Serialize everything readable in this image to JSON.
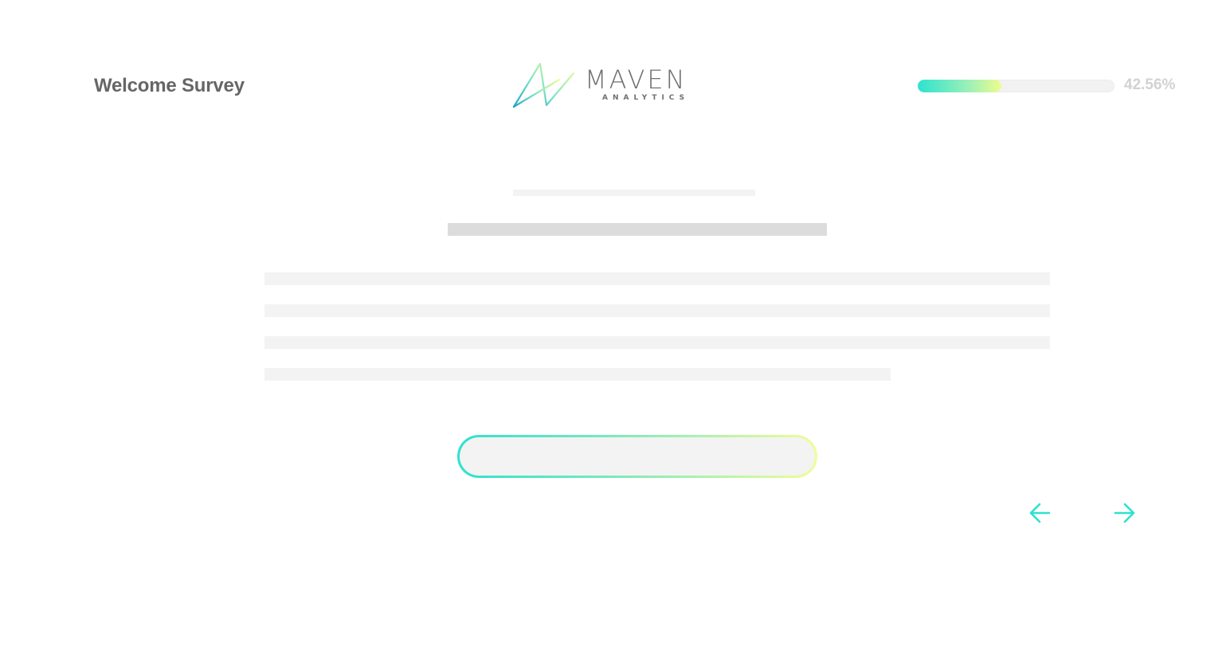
{
  "header": {
    "title": "Welcome Survey"
  },
  "logo": {
    "wordmark": "MAVEN",
    "tagline": "ANALYTICS",
    "icon": "maven-peak-mark"
  },
  "progress": {
    "percent": 42.56,
    "label": "42.56%"
  },
  "navigation": {
    "prev_icon": "arrow-left-icon",
    "next_icon": "arrow-right-icon"
  },
  "colors": {
    "accent_teal": "#2de2cf",
    "accent_yellow": "#eefc8f",
    "title_gray": "#666666",
    "label_gray": "#d2d2d2",
    "placeholder_light": "#f3f3f3",
    "placeholder_dark": "#dcdcdc"
  }
}
